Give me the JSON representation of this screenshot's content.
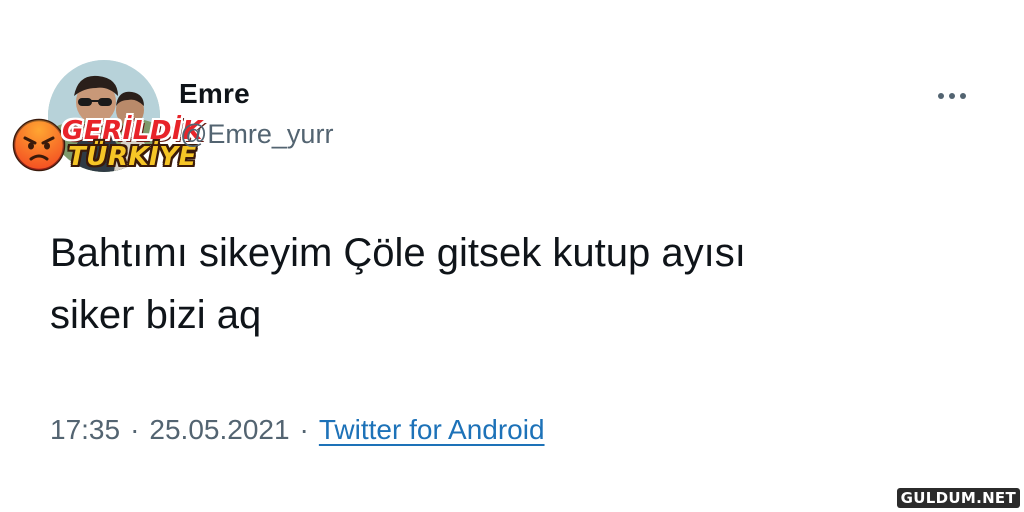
{
  "tweet": {
    "display_name": "Emre",
    "username": "@Emre_yurr",
    "text": "Bahtımı sikeyim Çöle gitsek kutup ayısı\nsiker bizi aq",
    "time": "17:35",
    "date": "25.05.2021",
    "separator": "·",
    "source": "Twitter for Android",
    "more_icon": "more-horizontal-icon"
  },
  "watermark": {
    "line1": "GERİLDİK",
    "line2": "TÜRKİYE",
    "site": "GULDUM.NET",
    "face_icon": "angry-face-icon"
  },
  "colors": {
    "text_primary": "#0f1419",
    "text_secondary": "#536471",
    "link": "#1d72b8",
    "badge_red": "#e8242a",
    "badge_yellow": "#f6c526"
  }
}
